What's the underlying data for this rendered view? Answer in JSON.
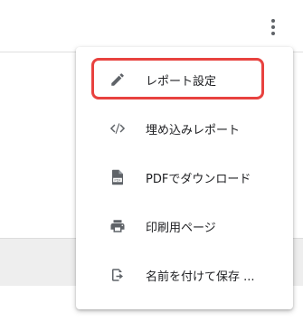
{
  "menu": {
    "items": [
      {
        "label": "レポート設定",
        "icon": "pencil-icon"
      },
      {
        "label": "埋め込みレポート",
        "icon": "code-icon"
      },
      {
        "label": "PDFでダウンロード",
        "icon": "pdf-file-icon"
      },
      {
        "label": "印刷用ページ",
        "icon": "printer-icon"
      },
      {
        "label": "名前を付けて保存 ...",
        "icon": "save-as-icon"
      }
    ]
  },
  "colors": {
    "highlight": "#e8423f",
    "icon": "#5f6368",
    "text": "#202124"
  }
}
